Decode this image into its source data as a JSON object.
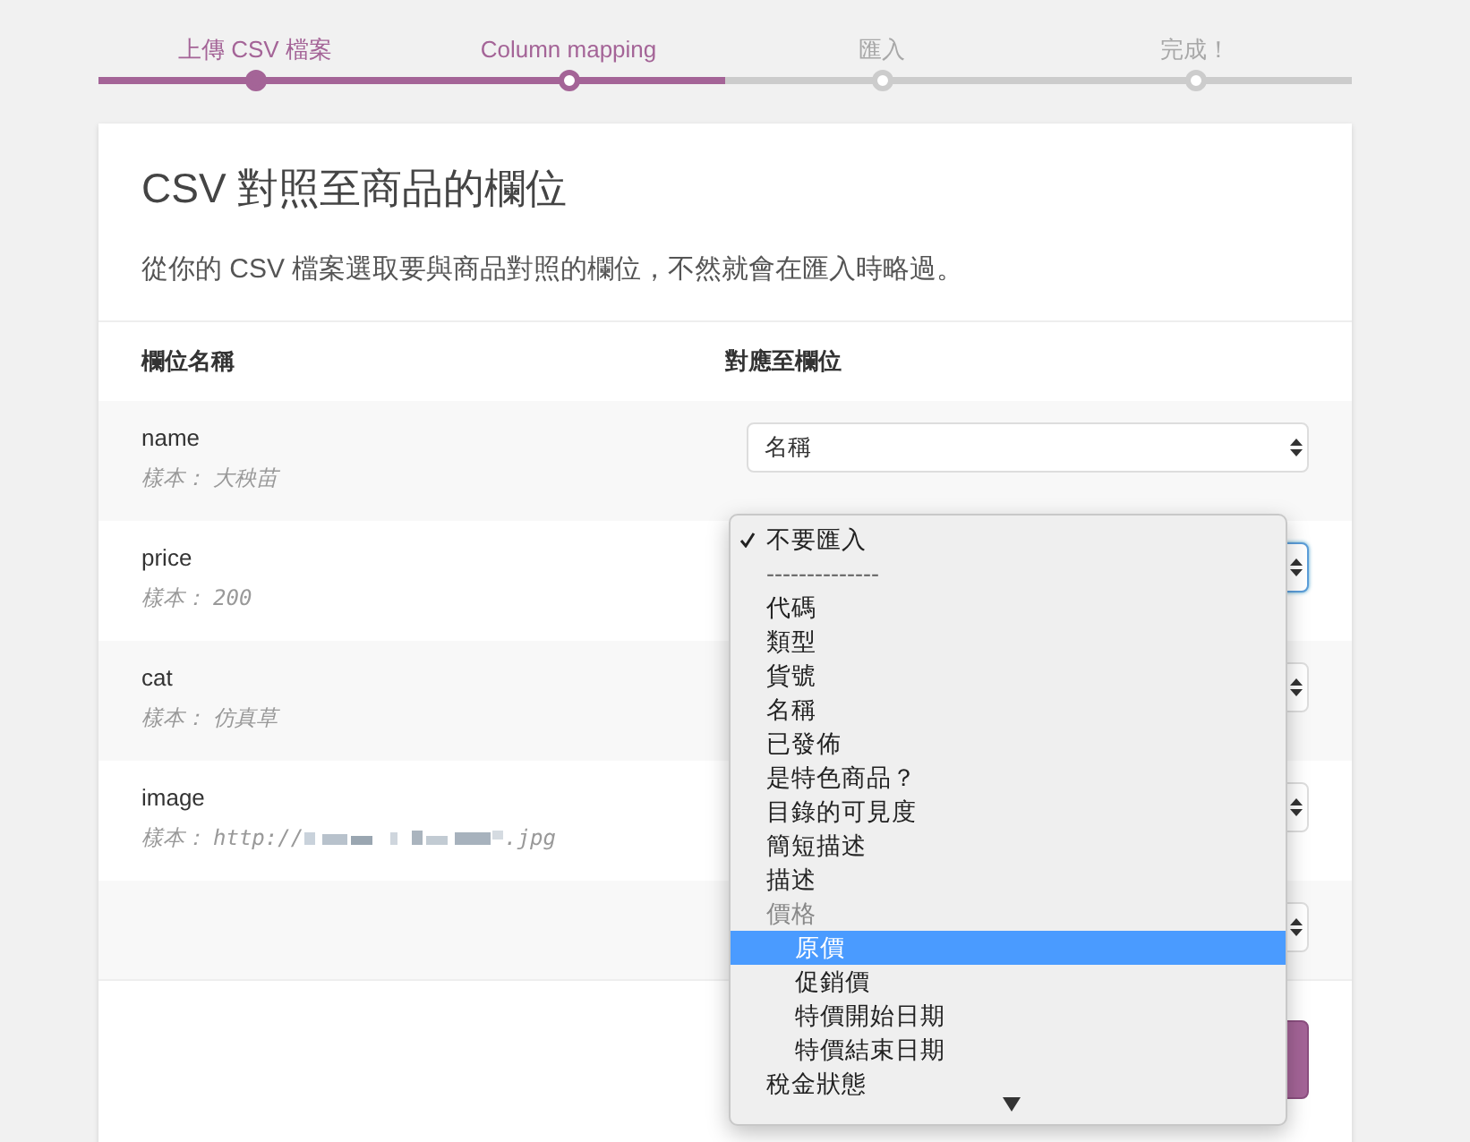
{
  "steps": [
    {
      "label": "上傳 CSV 檔案",
      "completed": true,
      "selected": false
    },
    {
      "label": "Column mapping",
      "completed": false,
      "selected": true
    },
    {
      "label": "匯入",
      "completed": false,
      "selected": false
    },
    {
      "label": "完成！",
      "completed": false,
      "selected": false
    }
  ],
  "card": {
    "title": "CSV 對照至商品的欄位",
    "description": "從你的 CSV 檔案選取要與商品對照的欄位，不然就會在匯入時略過。",
    "columns": [
      "欄位名稱",
      "對應至欄位"
    ],
    "rows": [
      {
        "name": "name",
        "sample_label": "樣本：",
        "sample": "大秧苗",
        "select": {
          "value": "名稱",
          "focused": false
        }
      },
      {
        "name": "price",
        "sample_label": "樣本：",
        "sample": "200",
        "select": {
          "focused": true
        }
      },
      {
        "name": "cat",
        "sample_label": "樣本：",
        "sample": "仿真草",
        "select": {
          "focused": false
        }
      },
      {
        "name": "image",
        "sample_label": "樣本：",
        "sample": "http://",
        "redacted": true,
        "sample_end": ".jpg",
        "select": {
          "focused": false
        }
      },
      {
        "select": {
          "focused": false
        }
      }
    ]
  },
  "dropdown": {
    "options": [
      {
        "kind": "option",
        "label": "不要匯入",
        "checked": true,
        "selected": false
      },
      {
        "kind": "separator",
        "label": "--------------"
      },
      {
        "kind": "option",
        "label": "代碼",
        "checked": false,
        "selected": false
      },
      {
        "kind": "option",
        "label": "類型",
        "checked": false,
        "selected": false
      },
      {
        "kind": "option",
        "label": "貨號",
        "checked": false,
        "selected": false
      },
      {
        "kind": "option",
        "label": "名稱",
        "checked": false,
        "selected": false
      },
      {
        "kind": "option",
        "label": "已發佈",
        "checked": false,
        "selected": false
      },
      {
        "kind": "option",
        "label": "是特色商品？",
        "checked": false,
        "selected": false
      },
      {
        "kind": "option",
        "label": "目錄的可見度",
        "checked": false,
        "selected": false
      },
      {
        "kind": "option",
        "label": "簡短描述",
        "checked": false,
        "selected": false
      },
      {
        "kind": "option",
        "label": "描述",
        "checked": false,
        "selected": false
      },
      {
        "kind": "group",
        "label": "價格"
      },
      {
        "kind": "suboption",
        "label": "原價",
        "checked": false,
        "selected": true
      },
      {
        "kind": "suboption",
        "label": "促銷價",
        "checked": false,
        "selected": false
      },
      {
        "kind": "suboption",
        "label": "特價開始日期",
        "checked": false,
        "selected": false
      },
      {
        "kind": "suboption",
        "label": "特價結束日期",
        "checked": false,
        "selected": false
      },
      {
        "kind": "option",
        "label": "稅金狀態",
        "checked": false,
        "selected": false
      }
    ]
  }
}
